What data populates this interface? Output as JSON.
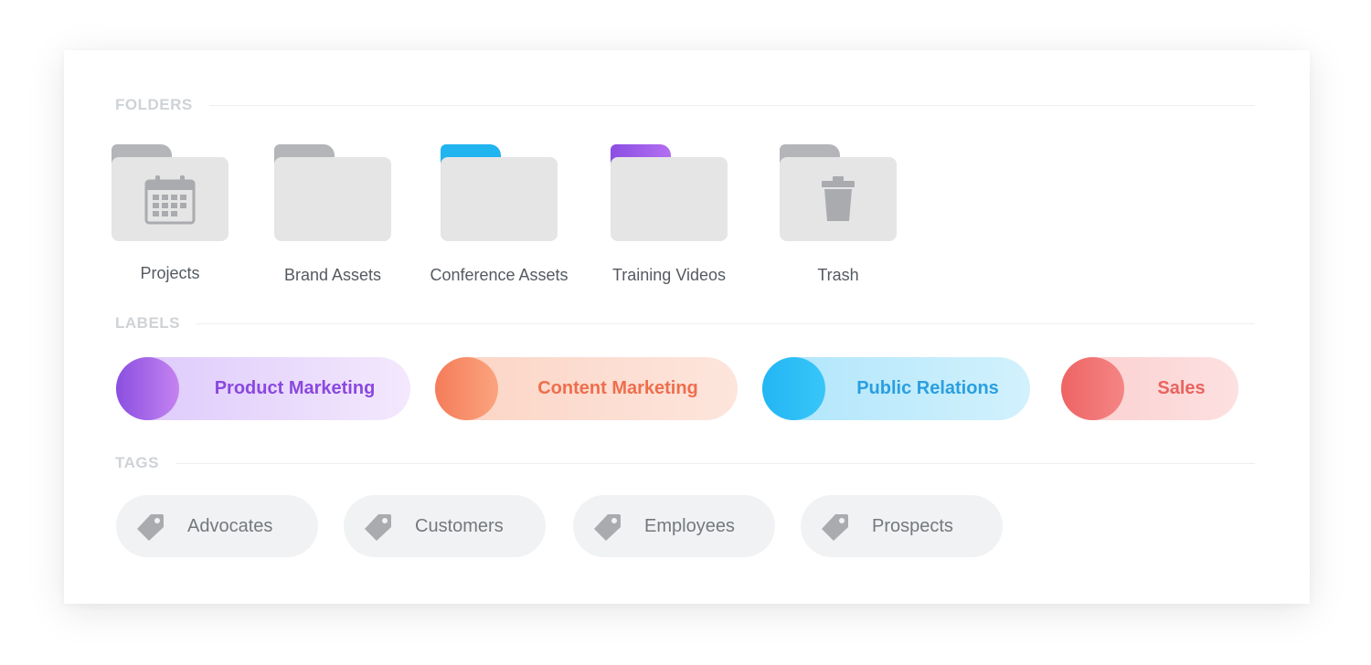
{
  "sections": {
    "folders_title": "FOLDERS",
    "labels_title": "LABELS",
    "tags_title": "TAGS"
  },
  "folders": [
    {
      "label": "Projects",
      "icon": "calendar-icon",
      "tab_color": "#b3b5b8"
    },
    {
      "label": "Brand Assets",
      "icon": "",
      "tab_color": "#b3b5b8"
    },
    {
      "label": "Conference Assets",
      "icon": "",
      "tab_color": "#21b4ef"
    },
    {
      "label": "Training Videos",
      "icon": "",
      "tab_color": "#9b5be6"
    },
    {
      "label": "Trash",
      "icon": "trash-icon",
      "tab_color": "#b3b5b8"
    }
  ],
  "labels": [
    {
      "label": "Product Marketing",
      "dot_from": "#8a4fe0",
      "dot_to": "#c583f0",
      "bg_from": "#dcc8fb",
      "bg_to": "#f3e8fd",
      "text_color": "#8a48df"
    },
    {
      "label": "Content Marketing",
      "dot_from": "#f57c5a",
      "dot_to": "#faa47e",
      "bg_from": "#fcd4c4",
      "bg_to": "#fde5dc",
      "text_color": "#ee6e4d"
    },
    {
      "label": "Public Relations",
      "dot_from": "#23b6f4",
      "dot_to": "#38c6f8",
      "bg_from": "#aee5fb",
      "bg_to": "#d2f1fd",
      "text_color": "#2a9fe0"
    },
    {
      "label": "Sales",
      "dot_from": "#ee6464",
      "dot_to": "#f58585",
      "bg_from": "#fbcfcf",
      "bg_to": "#fde0e0",
      "text_color": "#e8645f"
    }
  ],
  "tags": [
    {
      "label": "Advocates",
      "icon": "tag-icon"
    },
    {
      "label": "Customers",
      "icon": "tag-icon"
    },
    {
      "label": "Employees",
      "icon": "tag-icon"
    },
    {
      "label": "Prospects",
      "icon": "tag-icon"
    }
  ],
  "colors": {
    "folder_body": "#e5e5e5",
    "tag_bg": "#f1f2f3",
    "icon_gray": "#a9abae"
  }
}
